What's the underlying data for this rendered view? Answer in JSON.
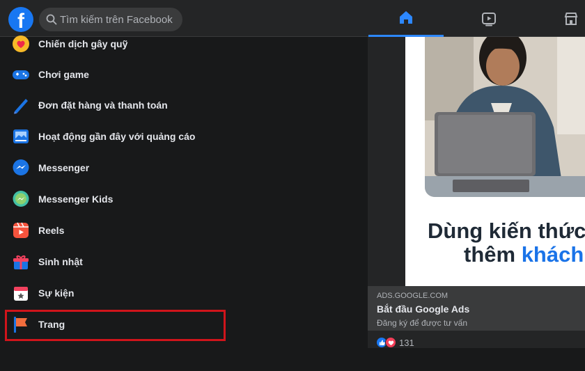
{
  "header": {
    "logo_letter": "f",
    "search": {
      "placeholder": "Tìm kiếm trên Facebook"
    },
    "tabs": [
      {
        "name": "home",
        "icon": "home-icon",
        "active": true
      },
      {
        "name": "watch",
        "icon": "video-icon",
        "active": false
      },
      {
        "name": "marketplace",
        "icon": "marketplace-icon",
        "active": false
      }
    ]
  },
  "sidebar": {
    "items": [
      {
        "label": "Chiến dịch gây quỹ",
        "icon": "fundraiser-icon"
      },
      {
        "label": "Chơi game",
        "icon": "gaming-icon"
      },
      {
        "label": "Đơn đặt hàng và thanh toán",
        "icon": "orders-payments-icon"
      },
      {
        "label": "Hoạt động gần đây với quảng cáo",
        "icon": "ad-activity-icon"
      },
      {
        "label": "Messenger",
        "icon": "messenger-icon"
      },
      {
        "label": "Messenger Kids",
        "icon": "messenger-kids-icon"
      },
      {
        "label": "Reels",
        "icon": "reels-icon"
      },
      {
        "label": "Sinh nhật",
        "icon": "birthday-icon"
      },
      {
        "label": "Sự kiện",
        "icon": "events-icon"
      },
      {
        "label": "Trang",
        "icon": "pages-flag-icon",
        "highlighted": true
      }
    ]
  },
  "ad": {
    "headline_line1": "Dùng kiến thức c",
    "headline_line2_plain": "thêm ",
    "headline_line2_accent": "khách",
    "domain": "ADS.GOOGLE.COM",
    "title": "Bắt đầu Google Ads",
    "subtitle": "Đăng ký để được tư vấn",
    "reaction_count": "131"
  },
  "colors": {
    "accent": "#2d88ff",
    "highlight_border": "#d0141b",
    "brand_blue": "#1877f2"
  }
}
